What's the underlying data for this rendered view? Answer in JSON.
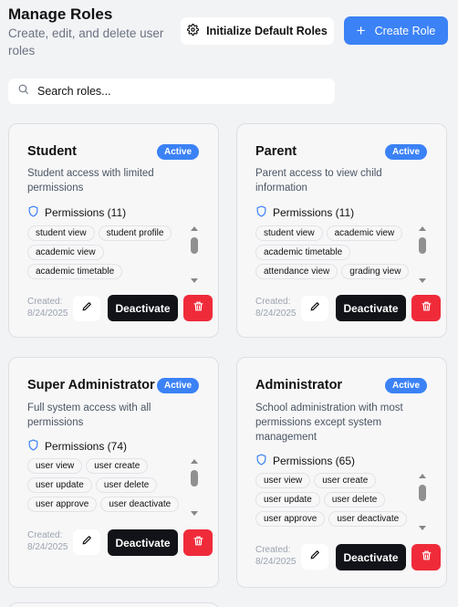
{
  "header": {
    "title": "Manage Roles",
    "subtitle": "Create, edit, and delete user roles",
    "init_button": "Initialize Default Roles",
    "create_button": "Create Role"
  },
  "search": {
    "placeholder": "Search roles..."
  },
  "colors": {
    "accent": "#3b82f6",
    "danger": "#ef2b3a",
    "dark_button": "#111318"
  },
  "roles": [
    {
      "name": "Student",
      "status": "Active",
      "description": "Student access with limited permissions",
      "permissions_label": "Permissions (11)",
      "tags": [
        "student view",
        "student profile",
        "academic view",
        "academic timetable"
      ],
      "created_label": "Created:",
      "created_date": "8/24/2025",
      "deactivate_label": "Deactivate"
    },
    {
      "name": "Parent",
      "status": "Active",
      "description": "Parent access to view child information",
      "permissions_label": "Permissions (11)",
      "tags": [
        "student view",
        "academic view",
        "academic timetable",
        "attendance view",
        "grading view"
      ],
      "created_label": "Created:",
      "created_date": "8/24/2025",
      "deactivate_label": "Deactivate"
    },
    {
      "name": "Super Administrator",
      "status": "Active",
      "description": "Full system access with all permissions",
      "permissions_label": "Permissions (74)",
      "tags": [
        "user view",
        "user create",
        "user update",
        "user delete",
        "user approve",
        "user deactivate"
      ],
      "created_label": "Created:",
      "created_date": "8/24/2025",
      "deactivate_label": "Deactivate"
    },
    {
      "name": "Administrator",
      "status": "Active",
      "description": "School administration with most permissions except system management",
      "permissions_label": "Permissions (65)",
      "tags": [
        "user view",
        "user create",
        "user update",
        "user delete",
        "user approve",
        "user deactivate"
      ],
      "created_label": "Created:",
      "created_date": "8/24/2025",
      "deactivate_label": "Deactivate"
    }
  ]
}
